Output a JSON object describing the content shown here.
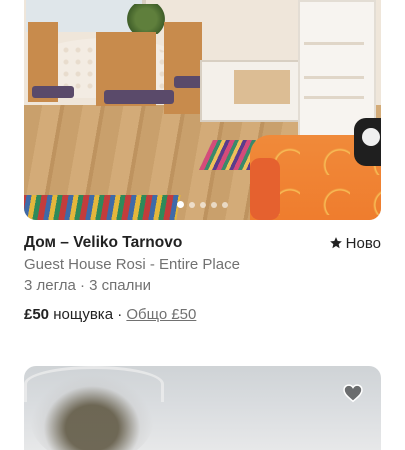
{
  "listings": [
    {
      "title": "Дом – Veliko Tarnovo",
      "rating_label": "Ново",
      "subtitle": "Guest House Rosi - Entire Place",
      "beds": "3 легла · 3 спални",
      "price": "£50",
      "price_unit": "нощувка",
      "separator": "·",
      "total": "Общо £50",
      "photo_count": 5,
      "active_photo": 0
    },
    {
      "favorited": false
    }
  ],
  "icons": {
    "rating": "star-icon",
    "favorite": "heart-icon"
  },
  "colors": {
    "primary_text": "#222222",
    "secondary_text": "#717171"
  }
}
